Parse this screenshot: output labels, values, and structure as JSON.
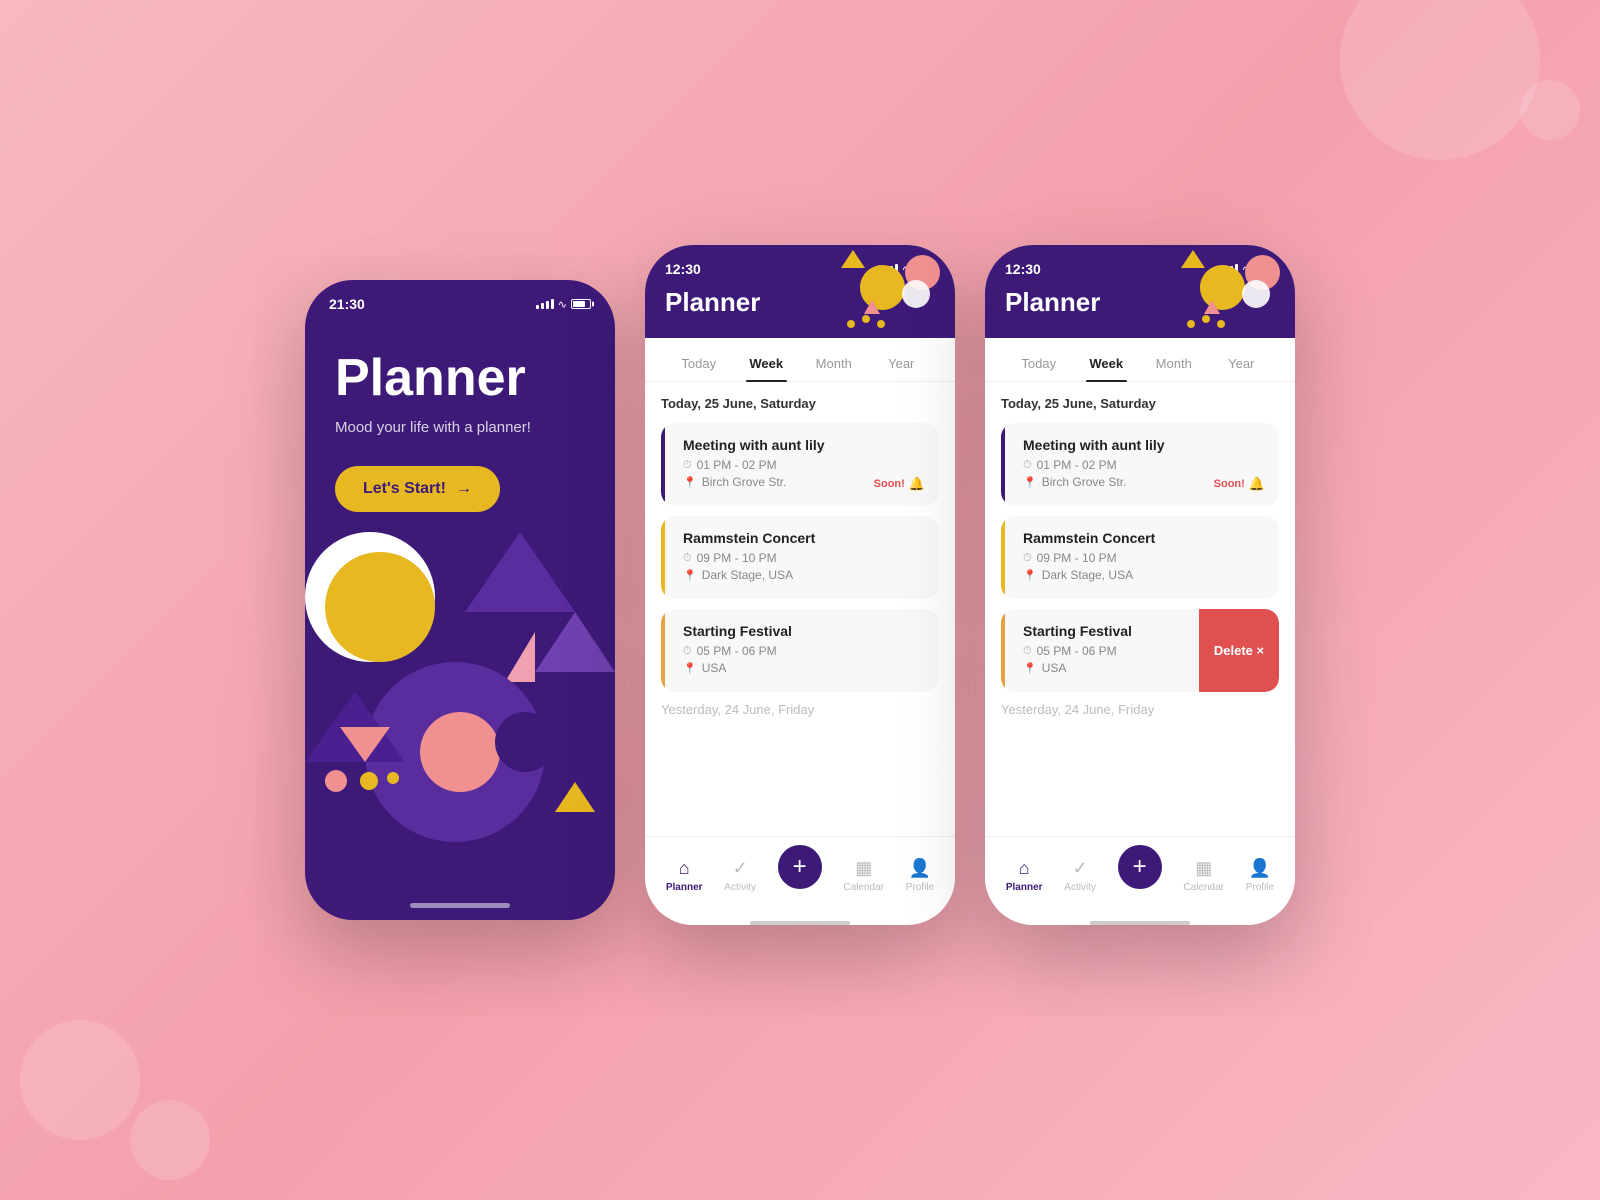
{
  "background": {
    "color": "#f9a8b0"
  },
  "phone1": {
    "status_time": "21:30",
    "title": "Planner",
    "subtitle": "Mood your life with a planner!",
    "start_btn": "Let's Start!",
    "arrow": "→"
  },
  "phone2": {
    "status_time": "12:30",
    "header_title": "Planner",
    "tabs": [
      "Today",
      "Week",
      "Month",
      "Year"
    ],
    "active_tab": "Week",
    "date_label": "Today, 25 June, Saturday",
    "events": [
      {
        "title": "Meeting with aunt lily",
        "time": "01 PM - 02 PM",
        "location": "Birch Grove Str.",
        "accent": "#3d1a78",
        "soon": true
      },
      {
        "title": "Rammstein Concert",
        "time": "09 PM - 10 PM",
        "location": "Dark Stage, USA",
        "accent": "#e8b820",
        "soon": false
      },
      {
        "title": "Starting Festival",
        "time": "05 PM - 06 PM",
        "location": "USA",
        "accent": "#e8a040",
        "soon": false
      }
    ],
    "yesterday_label": "Yesterday, 24 June, Friday",
    "nav": {
      "planner": "Planner",
      "activity": "Activity",
      "calendar": "Calendar",
      "profile": "Profile"
    }
  },
  "phone3": {
    "status_time": "12:30",
    "header_title": "Planner",
    "tabs": [
      "Today",
      "Week",
      "Month",
      "Year"
    ],
    "active_tab": "Week",
    "date_label": "Today, 25 June, Saturday",
    "events": [
      {
        "title": "Meeting with aunt lily",
        "time": "01 PM - 02 PM",
        "location": "Birch Grove Str.",
        "accent": "#3d1a78",
        "soon": true,
        "soon_text": "Soon!"
      },
      {
        "title": "Rammstein Concert",
        "time": "09 PM - 10 PM",
        "location": "Dark Stage, USA",
        "accent": "#e8b820",
        "soon": false
      },
      {
        "title": "Starting Festival",
        "time": "05 PM - 06 PM",
        "location": "USA",
        "accent": "#e8a040",
        "swipe": true,
        "delete_label": "Delete ×"
      }
    ],
    "yesterday_label": "Yesterday, 24 June, Friday",
    "nav": {
      "planner": "Planner",
      "activity": "Activity",
      "calendar": "Calendar",
      "profile": "Profile"
    }
  }
}
